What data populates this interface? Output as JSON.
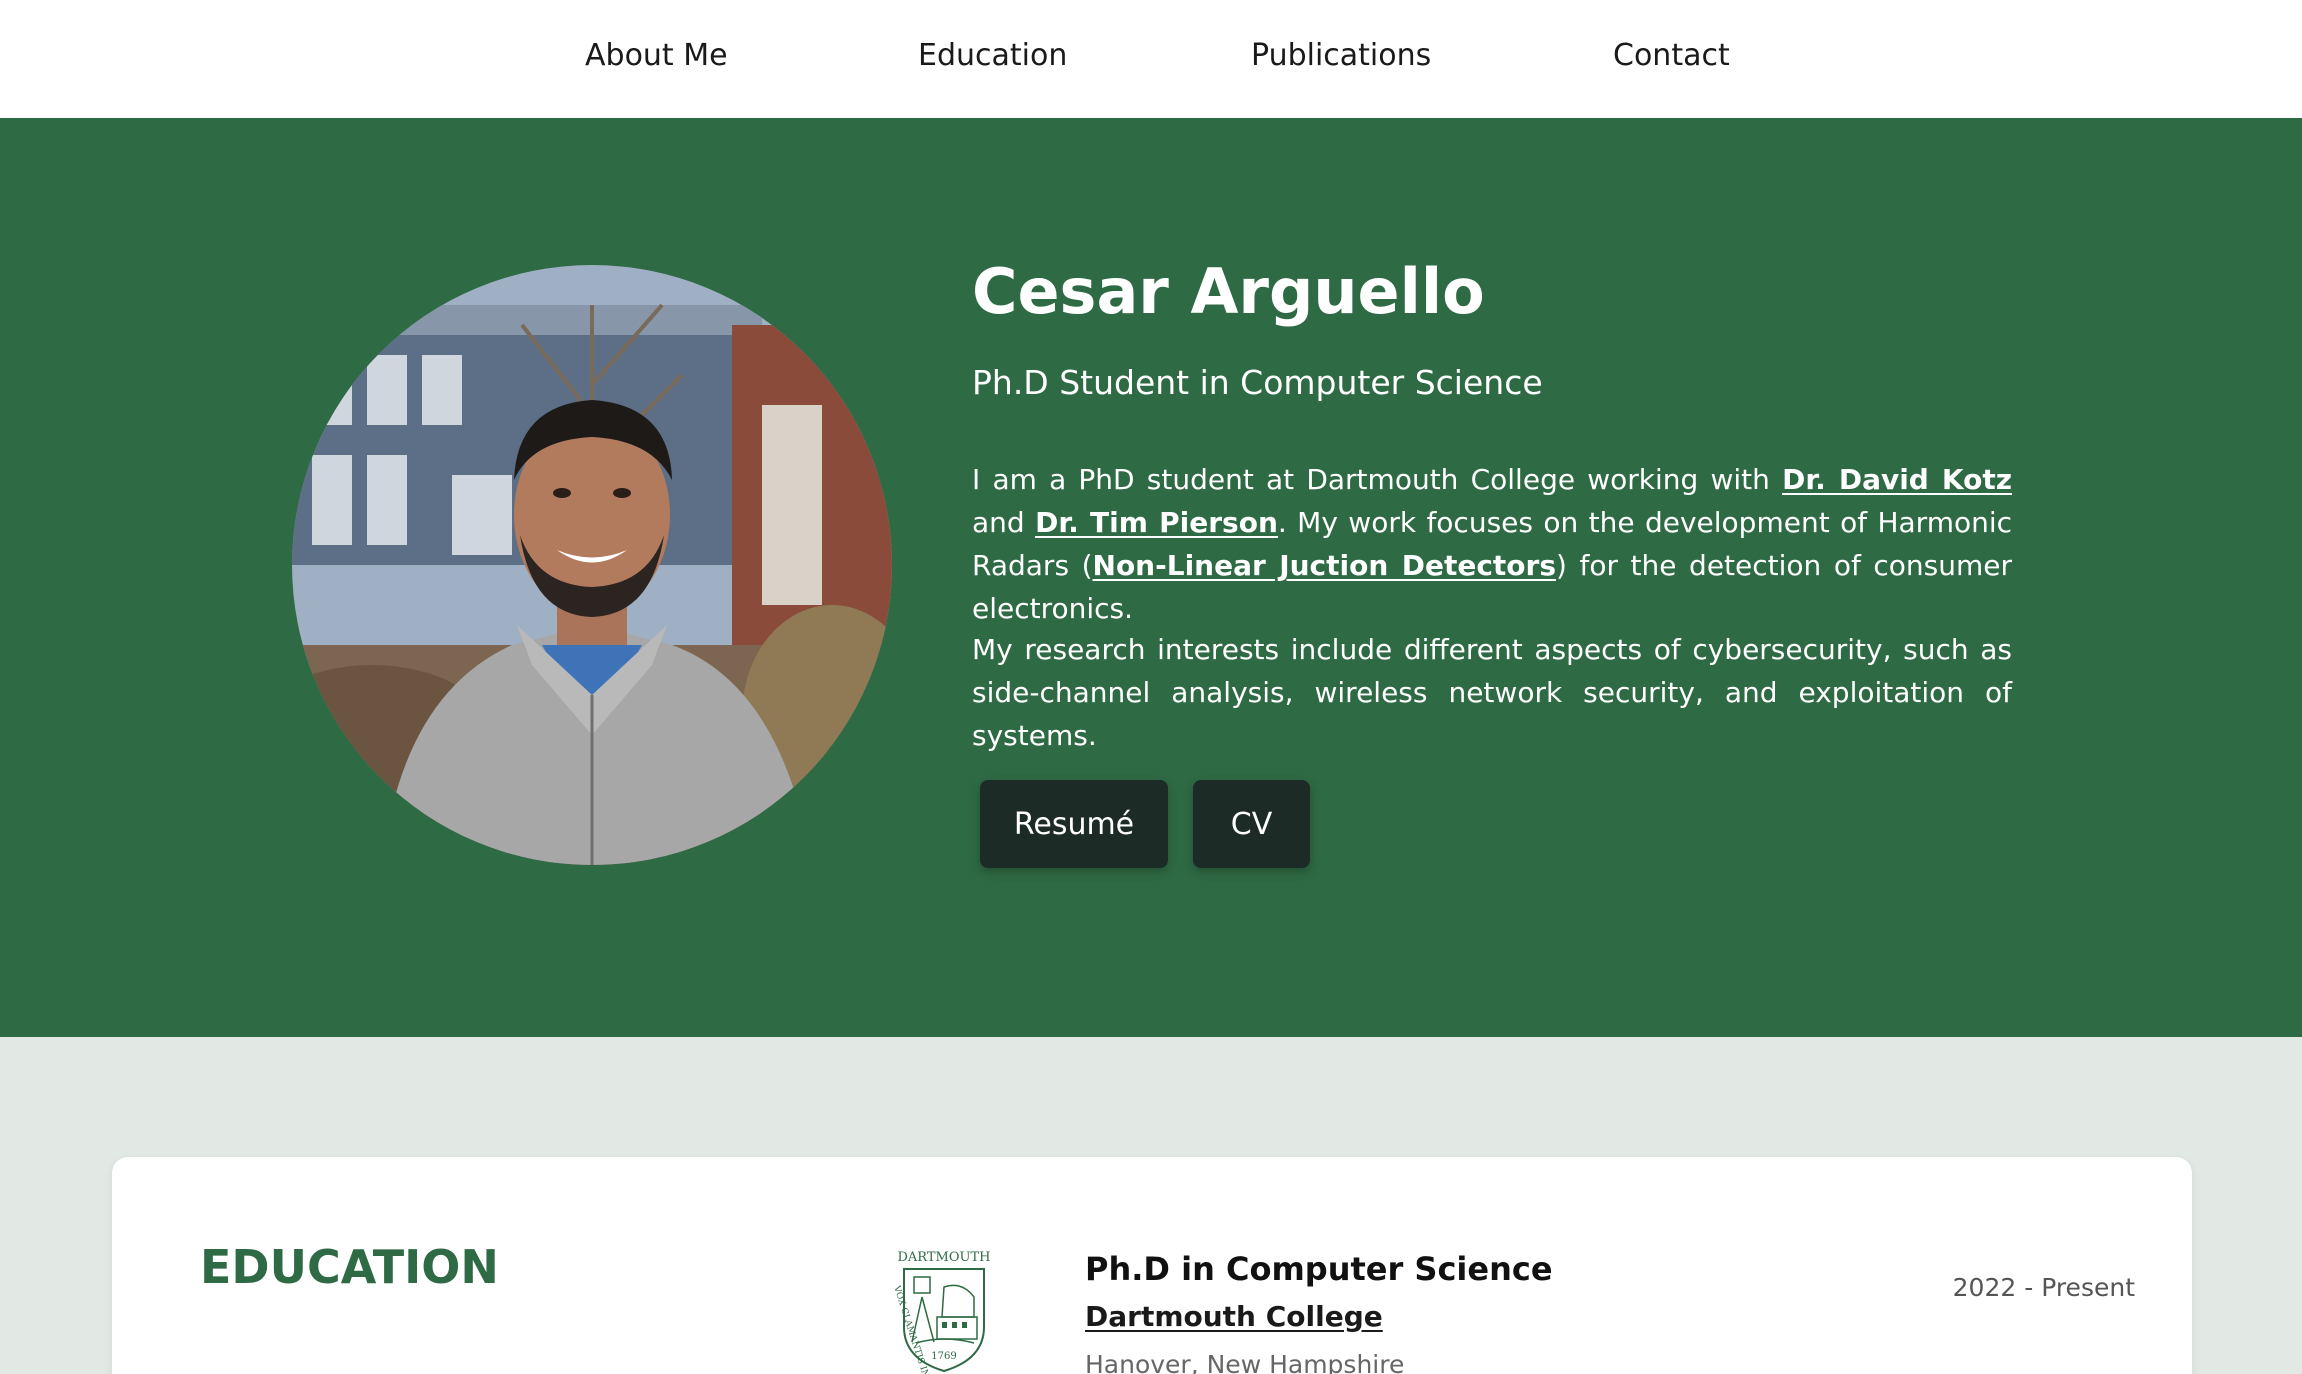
{
  "nav": {
    "items": [
      {
        "label": "About Me"
      },
      {
        "label": "Education"
      },
      {
        "label": "Publications"
      },
      {
        "label": "Contact"
      }
    ]
  },
  "hero": {
    "name": "Cesar Arguello",
    "subtitle": "Ph.D Student in Computer Science",
    "paragraph1": {
      "t1": "I am a PhD student at Dartmouth College working with ",
      "link1": "Dr. David Kotz",
      "t2": " and ",
      "link2": "Dr. Tim Pierson",
      "t3": ". My work focuses on the development of Harmonic Radars (",
      "link3": "Non-Linear Juction Detectors",
      "t4": ") for the detection of consumer electronics."
    },
    "paragraph2": "My research interests include different aspects of cybersecurity, such as side-channel analysis, wireless network security, and exploitation of systems.",
    "buttons": {
      "resume": "Resumé",
      "cv": "CV"
    },
    "colors": {
      "background": "#2e6a44",
      "button": "#1d2b27"
    }
  },
  "education": {
    "heading": "EDUCATION",
    "entries": [
      {
        "degree": "Ph.D in Computer Science",
        "school": "Dartmouth College",
        "location": "Hanover, New Hampshire",
        "dates": "2022 - Present",
        "seal_text_top": "DARTMOUTH",
        "seal_text_left": "VOX CLAMANTIS IN DESERTO",
        "seal_year": "1769"
      }
    ]
  }
}
